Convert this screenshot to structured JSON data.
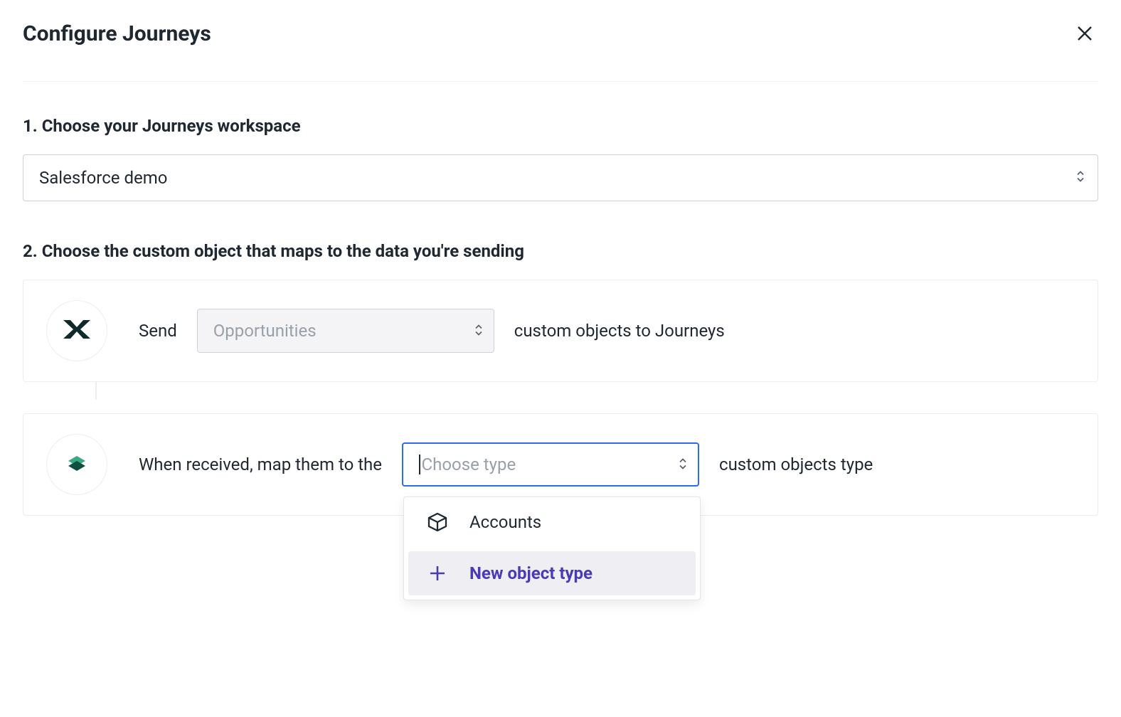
{
  "header": {
    "title": "Configure Journeys"
  },
  "step1": {
    "heading": "1. Choose your Journeys workspace",
    "workspace_select_value": "Salesforce demo"
  },
  "step2": {
    "heading": "2. Choose the custom object that maps to the data you're sending",
    "send": {
      "prefix": "Send",
      "select_placeholder": "Opportunities",
      "suffix": "custom objects to Journeys"
    },
    "receive": {
      "prefix": "When received, map them to the",
      "select_placeholder": "Choose type",
      "suffix": "custom objects type",
      "dropdown_options": [
        {
          "label": "Accounts"
        },
        {
          "label": "New object type"
        }
      ]
    }
  }
}
